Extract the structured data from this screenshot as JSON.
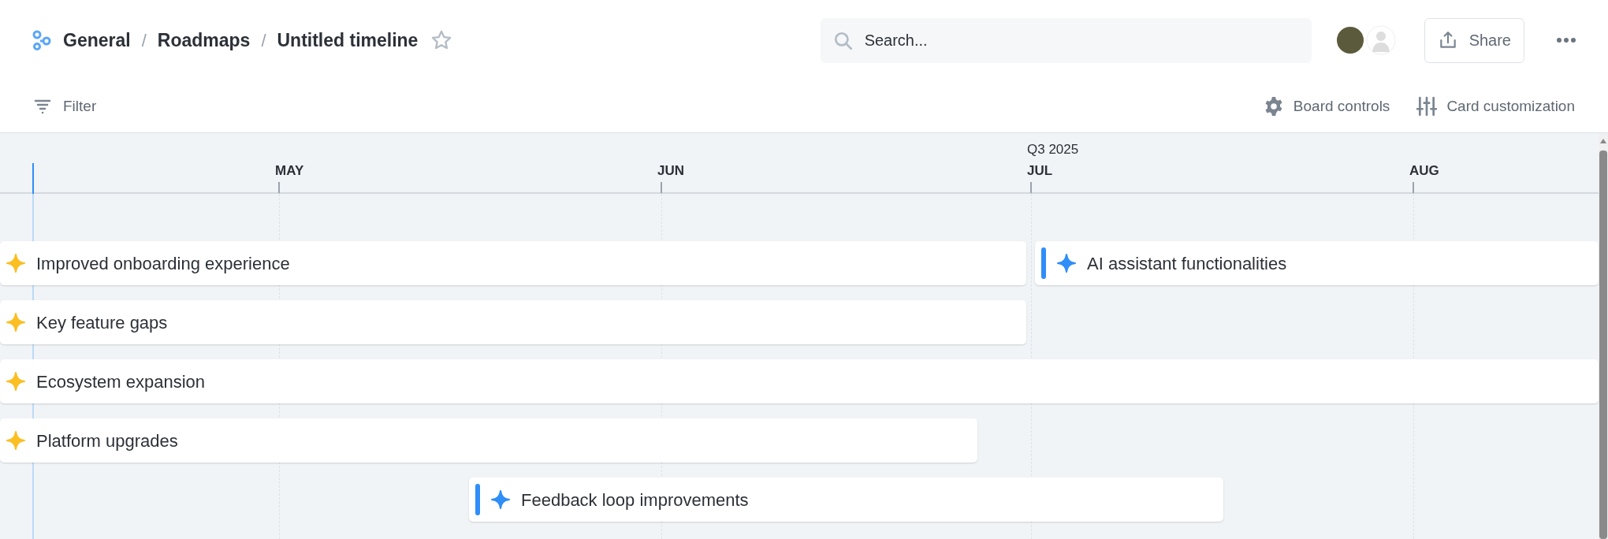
{
  "breadcrumb": [
    {
      "label": "General"
    },
    {
      "separator": "/",
      "label": "Roadmaps"
    },
    {
      "separator": "/",
      "label": "Untitled timeline"
    }
  ],
  "starred": false,
  "search": {
    "placeholder": "Search..."
  },
  "share_button": "Share",
  "toolbar": {
    "filter": "Filter",
    "board_controls": "Board controls",
    "card_customization": "Card customization"
  },
  "timeline": {
    "months": [
      {
        "label": "MAY"
      },
      {
        "label": "JUN"
      },
      {
        "label": "JUL",
        "quarter": "Q3 2025"
      },
      {
        "label": "AUG"
      }
    ],
    "items": [
      {
        "title": "Improved onboarding experience",
        "kind": "initiative"
      },
      {
        "title": "AI assistant functionalities",
        "kind": "epic"
      },
      {
        "title": "Key feature gaps",
        "kind": "initiative"
      },
      {
        "title": "Ecosystem expansion",
        "kind": "initiative"
      },
      {
        "title": "Platform upgrades",
        "kind": "initiative"
      },
      {
        "title": "Feedback loop improvements",
        "kind": "epic"
      }
    ]
  }
}
